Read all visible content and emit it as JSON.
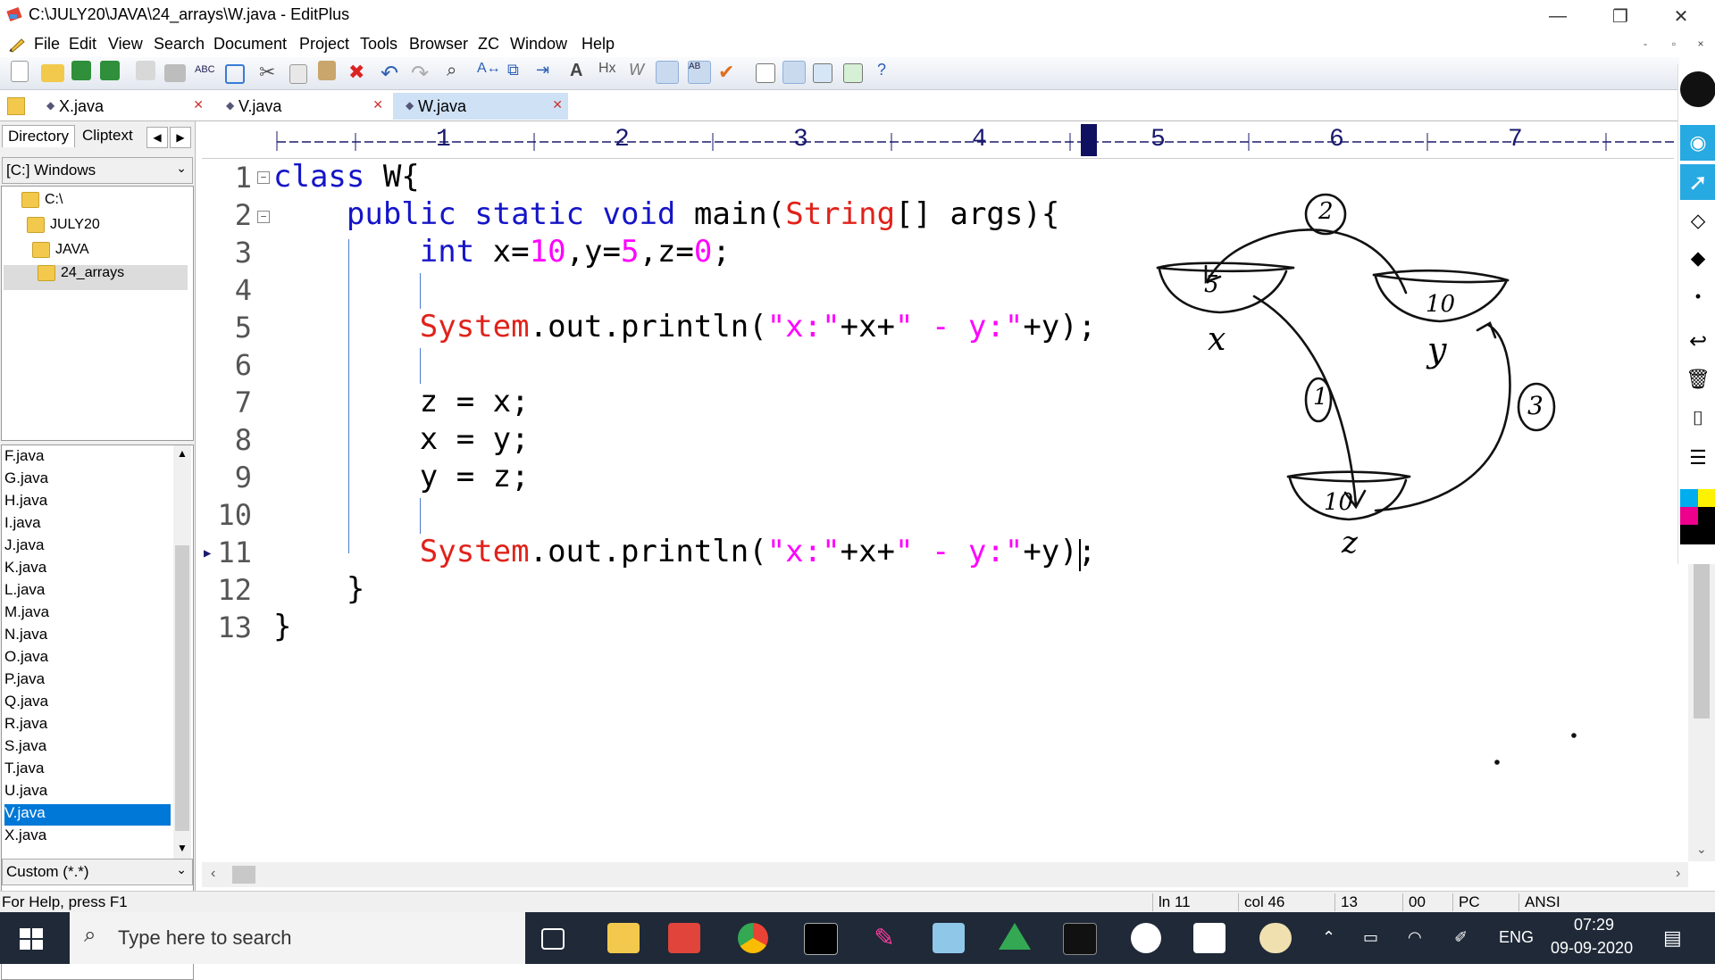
{
  "window": {
    "title": "C:\\JULY20\\JAVA\\24_arrays\\W.java - EditPlus",
    "minimize": "—",
    "restore": "❐",
    "close": "✕"
  },
  "menu": [
    "File",
    "Edit",
    "View",
    "Search",
    "Document",
    "Project",
    "Tools",
    "Browser",
    "ZC",
    "Window",
    "Help"
  ],
  "mdi_controls": [
    "-",
    "▫",
    "×"
  ],
  "tabs": [
    {
      "label": "X.java",
      "active": false
    },
    {
      "label": "V.java",
      "active": false
    },
    {
      "label": "W.java",
      "active": true
    }
  ],
  "left_panel": {
    "tabs": [
      "Directory",
      "Cliptext"
    ],
    "drive": "[C:] Windows",
    "tree": [
      "C:\\",
      "JULY20",
      "JAVA",
      "24_arrays"
    ],
    "files": [
      "F.java",
      "G.java",
      "H.java",
      "I.java",
      "J.java",
      "K.java",
      "L.java",
      "M.java",
      "N.java",
      "O.java",
      "P.java",
      "Q.java",
      "R.java",
      "S.java",
      "T.java",
      "U.java",
      "V.java",
      "X.java"
    ],
    "selected_file": "V.java",
    "filter": "Custom (*.*)"
  },
  "ruler": {
    "numbers": [
      "1",
      "2",
      "3",
      "4",
      "5",
      "6",
      "7"
    ]
  },
  "editor": {
    "line_numbers": [
      "1",
      "2",
      "3",
      "4",
      "5",
      "6",
      "7",
      "8",
      "9",
      "10",
      "11",
      "12",
      "13"
    ],
    "lines": [
      "class W{",
      "    public static void main(String[] args){",
      "        int x=10,y=5,z=0;",
      "",
      "        System.out.println(\"x:\"+x+\" - y:\"+y);",
      "",
      "        z = x;",
      "        x = y;",
      "        y = z;",
      "",
      "        System.out.println(\"x:\"+x+\" - y:\"+y);",
      "    }",
      "}"
    ],
    "current_line": "11"
  },
  "annotation": {
    "labels": [
      "5",
      "10",
      "10",
      "x",
      "y",
      "z",
      "1",
      "2",
      "3"
    ]
  },
  "status": {
    "help": "For Help, press F1",
    "line": "ln 11",
    "col": "col 46",
    "lines_total": "13",
    "code": "00",
    "mode": "PC",
    "encoding": "ANSI"
  },
  "taskbar": {
    "search_placeholder": "Type here to search",
    "language": "ENG",
    "time": "07:29",
    "date": "09-09-2020"
  }
}
